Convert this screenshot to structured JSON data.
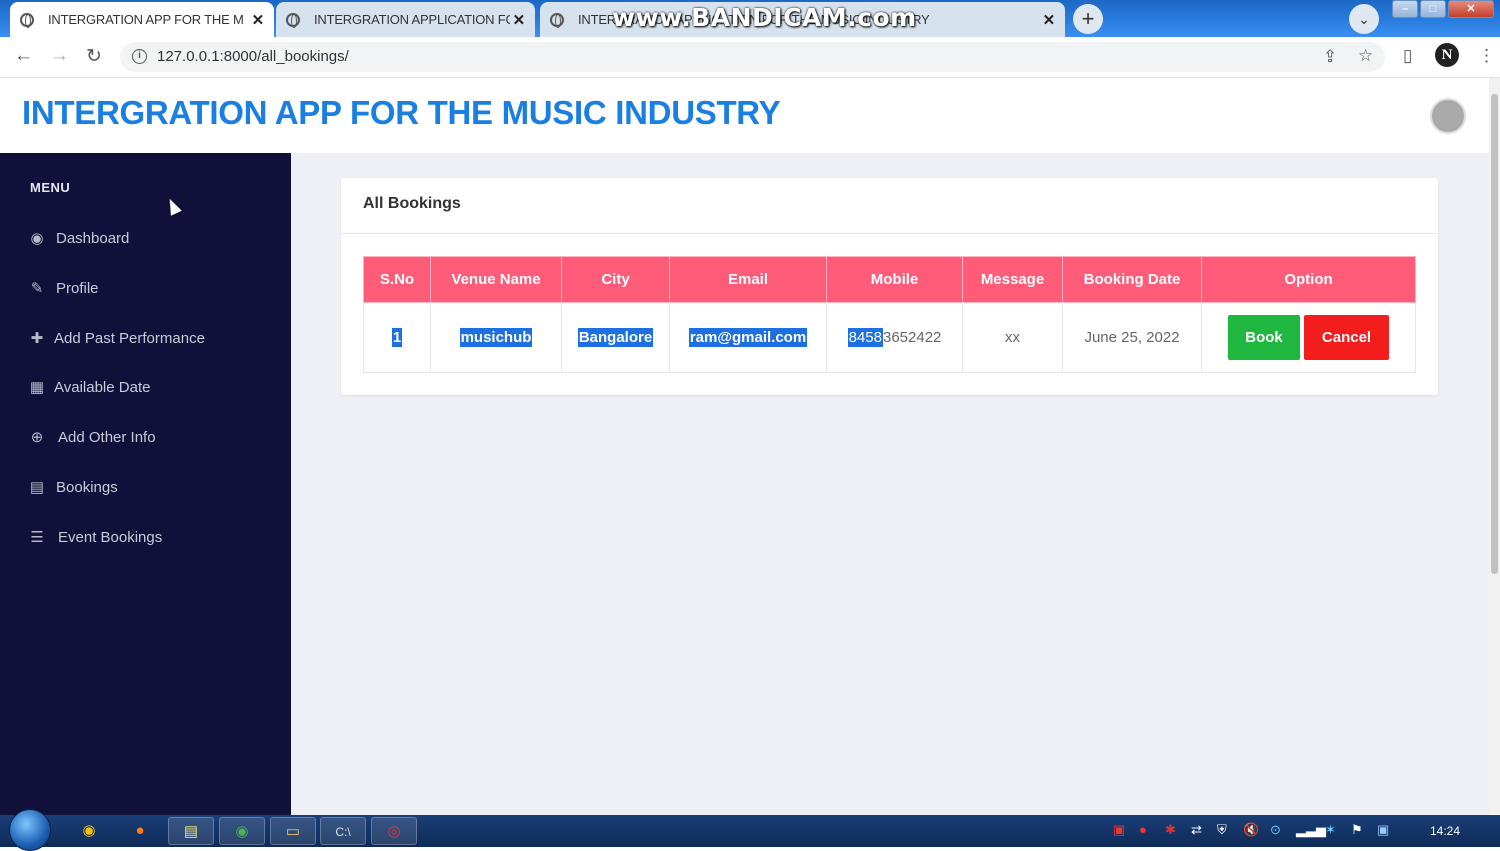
{
  "browser": {
    "tabs": [
      {
        "title": "INTERGRATION APP FOR THE MUSIC INDUSTRY",
        "active": true
      },
      {
        "title": "INTERGRATION APPLICATION FOR THE MUSIC INDUSTRY",
        "active": false
      },
      {
        "title": "INTERGRATION APPLICATION FOR THE MUSIC INDUSTRY",
        "active": false
      }
    ],
    "url": "127.0.0.1:8000/all_bookings/",
    "watermark": "www.BANDICAM.com"
  },
  "app": {
    "title": "INTERGRATION APP FOR THE MUSIC INDUSTRY"
  },
  "sidebar": {
    "heading": "MENU",
    "items": [
      {
        "label": "Dashboard",
        "icon": "user-circle-icon"
      },
      {
        "label": "Profile",
        "icon": "edit-icon"
      },
      {
        "label": "Add Past Performance",
        "icon": "plus-icon"
      },
      {
        "label": "Available Date",
        "icon": "calendar-grid-icon"
      },
      {
        "label": "Add Other Info",
        "icon": "plus-circle-icon"
      },
      {
        "label": "Bookings",
        "icon": "calendar-icon"
      },
      {
        "label": "Event Bookings",
        "icon": "list-icon"
      }
    ]
  },
  "bookings": {
    "heading": "All Bookings",
    "columns": [
      "S.No",
      "Venue Name",
      "City",
      "Email",
      "Mobile",
      "Message",
      "Booking Date",
      "Option"
    ],
    "rows": [
      {
        "sno": "1",
        "venue": "musichub",
        "city": "Bangalore",
        "email": "ram@gmail.com",
        "mobile_selected": "8458",
        "mobile_rest": "3652422",
        "message": "xx",
        "date": "June 25, 2022",
        "book_label": "Book",
        "cancel_label": "Cancel"
      }
    ]
  },
  "taskbar": {
    "clock": "14:24"
  },
  "colors": {
    "title_blue": "#1a7fe0",
    "sidebar_bg": "#10103a",
    "table_header": "#ff5c7a",
    "book_green": "#1fb73f",
    "cancel_red": "#f41d1d",
    "selection_blue": "#1e6fe0"
  }
}
